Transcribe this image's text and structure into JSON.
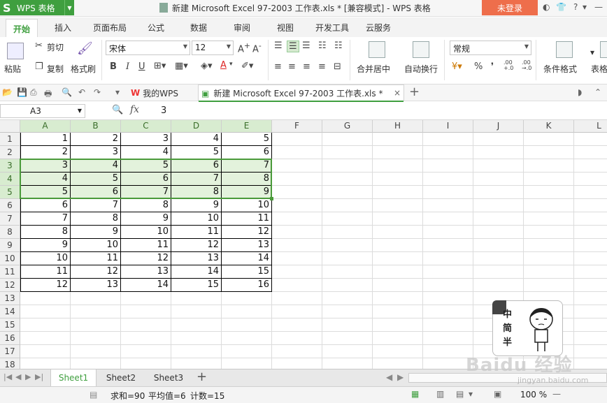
{
  "titlebar": {
    "app_name": "WPS 表格",
    "app_logo": "S",
    "doc_title": "新建 Microsoft Excel 97-2003 工作表.xls * [兼容模式] - WPS 表格",
    "login": "未登录",
    "icons": [
      "skin-icon",
      "shirt-icon",
      "help-icon",
      "minimize-icon"
    ]
  },
  "tabs": [
    "开始",
    "插入",
    "页面布局",
    "公式",
    "数据",
    "审阅",
    "视图",
    "开发工具",
    "云服务"
  ],
  "ribbon": {
    "paste": "粘贴",
    "cut": "剪切",
    "copy": "复制",
    "format_painter": "格式刷",
    "font_name": "宋体",
    "font_size": "12",
    "bold": "B",
    "italic": "I",
    "underline": "U",
    "merge_center": "合并居中",
    "wrap_text": "自动换行",
    "number_format": "常规",
    "percent": "%",
    "comma": "❜",
    "inc_decimal": ".00 +.0",
    "dec_decimal": ".00 →.0",
    "conditional_format": "条件格式",
    "table_format": "表格"
  },
  "quickbar": {
    "tab_mywps": "我的WPS",
    "tab_excel": "新建 Microsoft Excel 97-2003 工作表.xls *",
    "close": "×",
    "add": "+"
  },
  "formula_bar": {
    "name_box": "A3",
    "fx": "fx",
    "value": "3"
  },
  "grid": {
    "columns": [
      "A",
      "B",
      "C",
      "D",
      "E",
      "F",
      "G",
      "H",
      "I",
      "J",
      "K",
      "L"
    ],
    "rows": [
      "1",
      "2",
      "3",
      "4",
      "5",
      "6",
      "7",
      "8",
      "9",
      "10",
      "11",
      "12",
      "13",
      "14",
      "15",
      "16",
      "17",
      "18"
    ],
    "data": [
      [
        1,
        2,
        3,
        4,
        5
      ],
      [
        2,
        3,
        4,
        5,
        6
      ],
      [
        3,
        4,
        5,
        6,
        7
      ],
      [
        4,
        5,
        6,
        7,
        8
      ],
      [
        5,
        6,
        7,
        8,
        9
      ],
      [
        6,
        7,
        8,
        9,
        10
      ],
      [
        7,
        8,
        9,
        10,
        11
      ],
      [
        8,
        9,
        10,
        11,
        12
      ],
      [
        9,
        10,
        11,
        12,
        13
      ],
      [
        10,
        11,
        12,
        13,
        14
      ],
      [
        11,
        12,
        13,
        14,
        15
      ],
      [
        12,
        13,
        14,
        15,
        16
      ]
    ],
    "selected_rows": [
      3,
      4,
      5
    ],
    "selected_cols": [
      "A",
      "B",
      "C",
      "D",
      "E"
    ],
    "highlight_color": "#e3f2dc",
    "selection_color": "#4a9a3a"
  },
  "sticker": {
    "text": [
      "中",
      "简",
      "半"
    ]
  },
  "sheets": {
    "tabs": [
      "Sheet1",
      "Sheet2",
      "Sheet3"
    ],
    "active": "Sheet1",
    "add": "+"
  },
  "statusbar": {
    "sum": "求和=90",
    "average": "平均值=6",
    "count": "计数=15",
    "zoom": "100 %"
  },
  "watermark": {
    "text": "Baidu 经验",
    "url": "jingyan.baidu.com"
  },
  "colors": {
    "accent": "#3f9f3f",
    "login": "#ee6e4b"
  }
}
